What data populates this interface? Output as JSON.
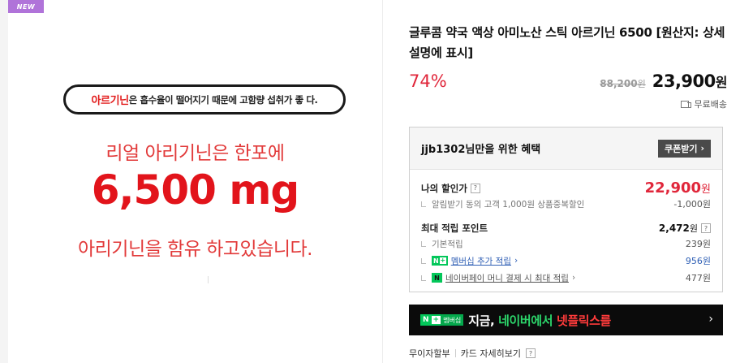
{
  "image": {
    "badge": "NEW",
    "pill_highlight": "아르기닌",
    "pill_text": "은 흡수율이 떨어지기 때문에 고함량 섭취가 좋 다.",
    "line1": "리얼 아리기닌은 한포에",
    "big": "6,500 mg",
    "line2": "아리기닌을 함유 하고있습니다."
  },
  "product": {
    "title": "글루콤 약국 액상 아미노산 스틱 아르기닌 6500 [원산지: 상세설명에 표시]",
    "discount": "74%",
    "original_price": "88,200",
    "original_unit": "원",
    "sale_price": "23,900",
    "sale_unit": "원",
    "shipping": "무료배송"
  },
  "benefit": {
    "title": "jjb1302님만을 위한 혜택",
    "coupon_button": "쿠폰받기",
    "my_discount_label": "나의 할인가",
    "my_discount_price": "22,900",
    "my_discount_unit": "원",
    "alert_label": "알림받기 동의 고객 1,000원 상품중복할인",
    "alert_value": "-1,000원",
    "max_points_label": "최대 적립 포인트",
    "max_points_value": "2,472",
    "max_points_unit": "원",
    "basic_label": "기본적립",
    "basic_value": "239원",
    "membership_label": "멤버십 추가 적립",
    "membership_value": "956원",
    "npay_label": "네이버페이 머니 결제 시 최대 적립",
    "npay_value": "477원",
    "help": "?"
  },
  "banner": {
    "badge_n": "N",
    "badge_plus": "+",
    "badge_label": "멤버십",
    "text1": "지금, ",
    "text2": "네이버에서 ",
    "text3": "넷플릭스를",
    "arrow": "›"
  },
  "links": {
    "installment": "무이자할부",
    "card": "카드 자세히보기"
  },
  "colors": {
    "accent_red": "#e0263a",
    "naver_green": "#03c75a",
    "new_badge": "#b073d9"
  }
}
